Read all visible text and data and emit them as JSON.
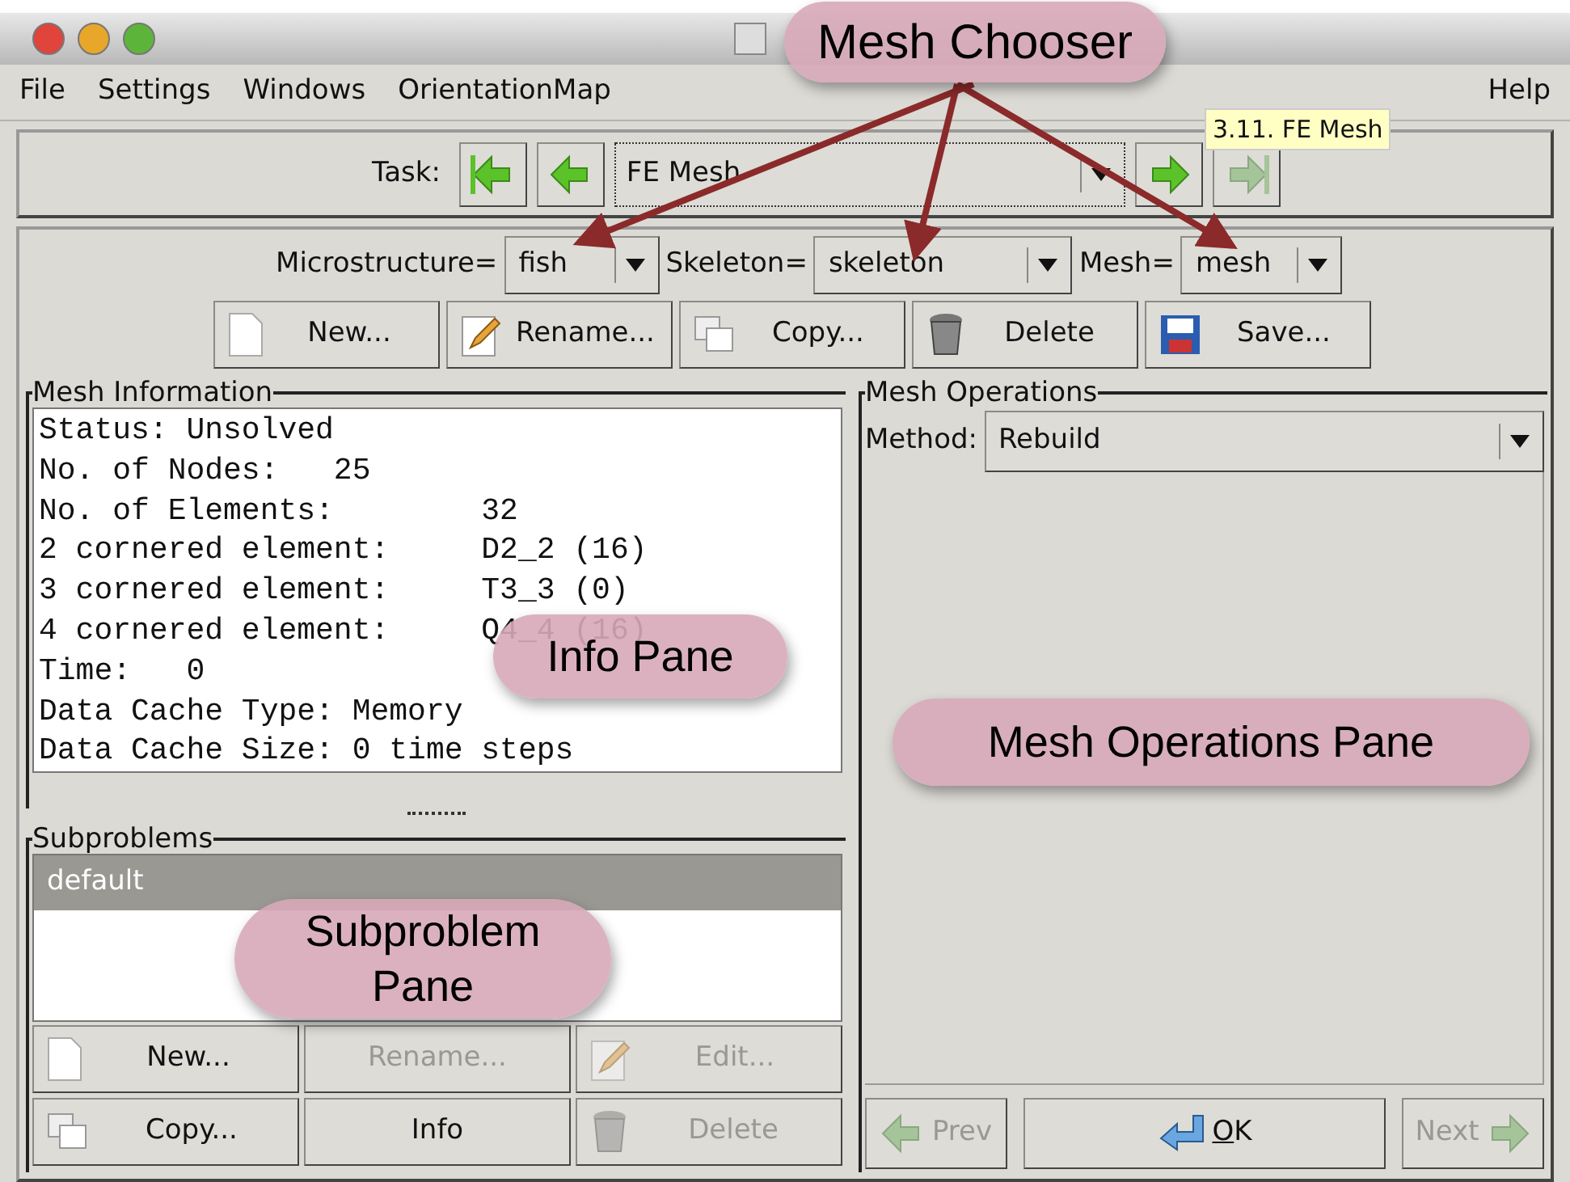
{
  "menu": [
    {
      "label": "File"
    },
    {
      "label": "Settings"
    },
    {
      "label": "Windows"
    },
    {
      "label": "OrientationMap"
    }
  ],
  "help_menu": "Help",
  "task": {
    "label": "Task:",
    "value": "FE Mesh",
    "tooltip": "3.11. FE Mesh",
    "nav_buttons": [
      {
        "kind": "first",
        "disabled": false
      },
      {
        "kind": "prev",
        "disabled": false
      },
      {
        "kind": "next",
        "disabled": false
      },
      {
        "kind": "last",
        "disabled": true
      }
    ]
  },
  "chooser": [
    {
      "label": "Microstructure=",
      "value": "fish"
    },
    {
      "label": "Skeleton=",
      "value": "skeleton"
    },
    {
      "label": "Mesh=",
      "value": "mesh"
    }
  ],
  "mesh_buttons": [
    {
      "kind": "new",
      "label": "New...",
      "disabled": false
    },
    {
      "kind": "rename",
      "label": "Rename...",
      "disabled": false
    },
    {
      "kind": "copy",
      "label": "Copy...",
      "disabled": false
    },
    {
      "kind": "delete",
      "label": "Delete",
      "disabled": false
    },
    {
      "kind": "save",
      "label": "Save...",
      "disabled": false
    }
  ],
  "mesh_information": {
    "title": "Mesh Information",
    "lines": [
      "Status: Unsolved",
      "No. of Nodes:   25",
      "No. of Elements:        32",
      "2 cornered element:     D2_2 (16)",
      "3 cornered element:     T3_3 (0)",
      "4 cornered element:     Q4_4 (16)",
      "Time:   0",
      "Data Cache Type: Memory",
      "Data Cache Size: 0 time steps"
    ]
  },
  "subproblems": {
    "title": "Subproblems",
    "items": [
      {
        "label": "default",
        "selected": true
      }
    ],
    "buttons": [
      {
        "kind": "new",
        "label": "New...",
        "disabled": false
      },
      {
        "kind": "none",
        "label": "Rename...",
        "disabled": true
      },
      {
        "kind": "edit",
        "label": "Edit...",
        "disabled": true
      },
      {
        "kind": "copy",
        "label": "Copy...",
        "disabled": false
      },
      {
        "kind": "none",
        "label": "Info",
        "disabled": false
      },
      {
        "kind": "delete",
        "label": "Delete",
        "disabled": true
      }
    ]
  },
  "mesh_operations": {
    "title": "Mesh Operations",
    "method_label": "Method:",
    "method": "Rebuild",
    "buttons": [
      {
        "kind": "prev",
        "label": "Prev",
        "disabled": true
      },
      {
        "kind": "ok",
        "label": "OK",
        "disabled": false
      },
      {
        "kind": "next",
        "label": "Next",
        "disabled": true
      }
    ]
  },
  "annotations": [
    {
      "text": "Mesh Chooser"
    },
    {
      "text": "Info Pane"
    },
    {
      "text": "Mesh Operations Pane"
    },
    {
      "text": "Subproblem Pane"
    }
  ]
}
